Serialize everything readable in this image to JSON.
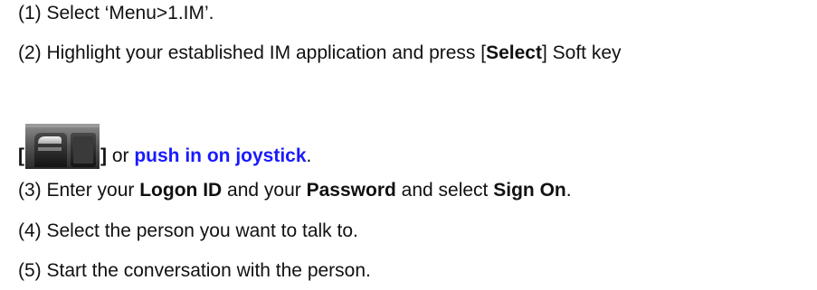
{
  "steps": {
    "s1": {
      "text": "(1) Select ‘Menu>1.IM’."
    },
    "s2": {
      "prefix": "(2) Highlight your established IM application and press [",
      "bold": "Select",
      "suffix": "] Soft key"
    },
    "s2b": {
      "open": "[",
      "close": "]",
      "mid": " or ",
      "link": "push in on joystick",
      "end": "."
    },
    "s3": {
      "p1": "(3) Enter your ",
      "b1": "Logon ID",
      "p2": " and your ",
      "b2": "Password",
      "p3": " and select ",
      "b3": "Sign On",
      "p4": "."
    },
    "s4": {
      "text": "(4) Select the person you want to talk to."
    },
    "s5": {
      "text": "(5) Start the conversation with the person."
    }
  },
  "icons": {
    "softkey": "phone-soft-key-icon"
  },
  "colors": {
    "link": "#1a1aff",
    "text": "#111111"
  }
}
